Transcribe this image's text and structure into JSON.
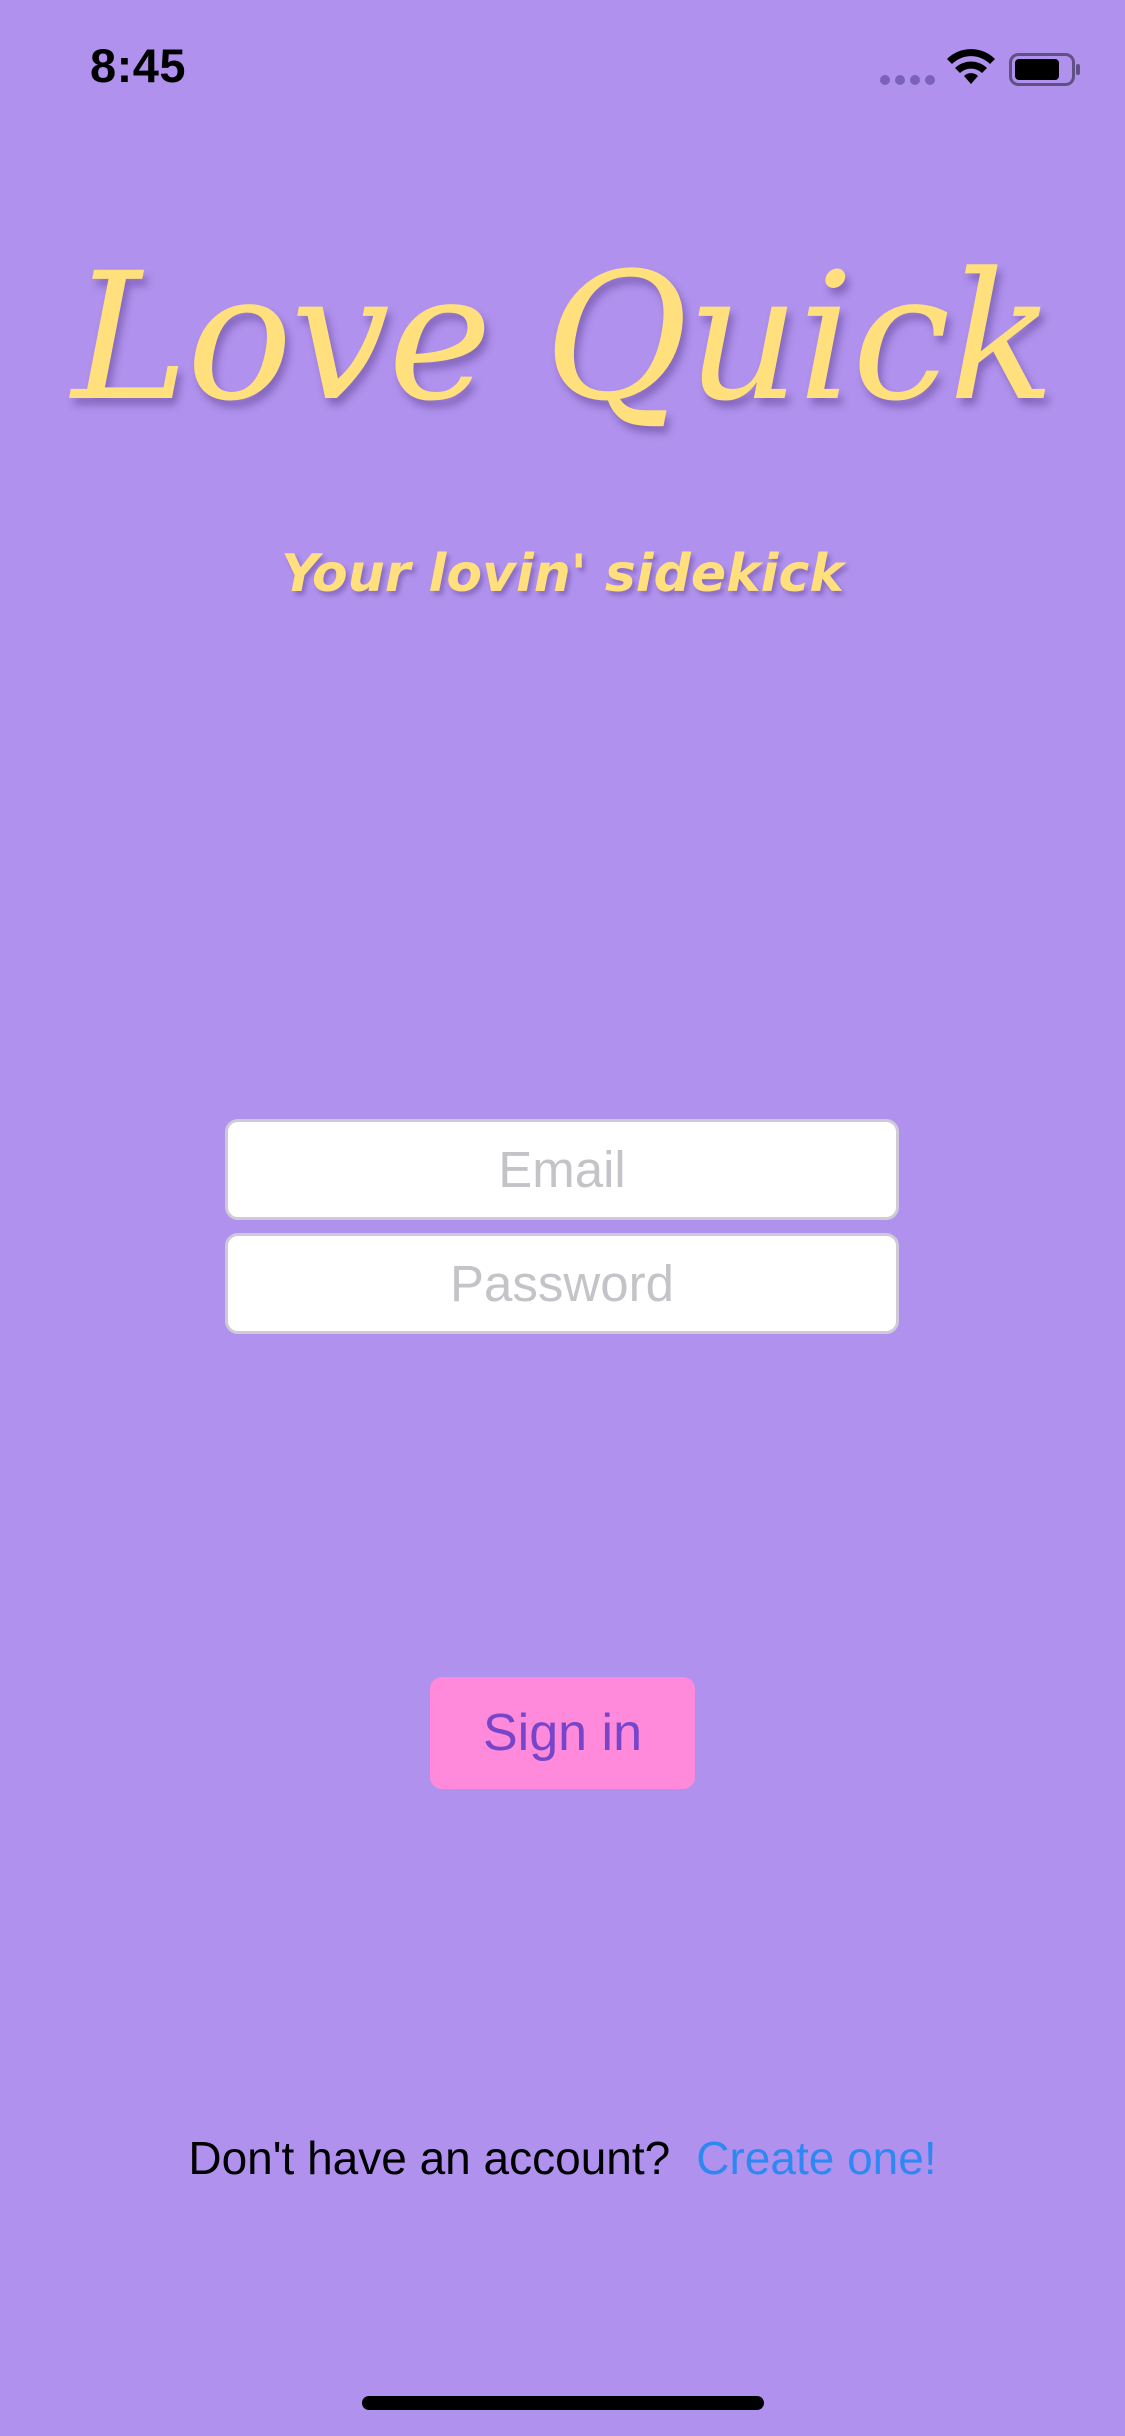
{
  "status_bar": {
    "time": "8:45",
    "signal_icon": "cellular-dots-icon",
    "wifi_icon": "wifi-icon",
    "battery_icon": "battery-icon"
  },
  "header": {
    "title": "Love Quick",
    "subtitle": "Your lovin' sidekick"
  },
  "form": {
    "email": {
      "value": "",
      "placeholder": "Email"
    },
    "password": {
      "value": "",
      "placeholder": "Password"
    },
    "signin_label": "Sign in"
  },
  "footer": {
    "prompt": "Don't have an account?",
    "link_label": "Create one!"
  },
  "colors": {
    "background": "#b092ee",
    "title": "#ffe07d",
    "button": "#ff8adb",
    "button_text": "#7645c9",
    "link": "#2f88f2"
  }
}
